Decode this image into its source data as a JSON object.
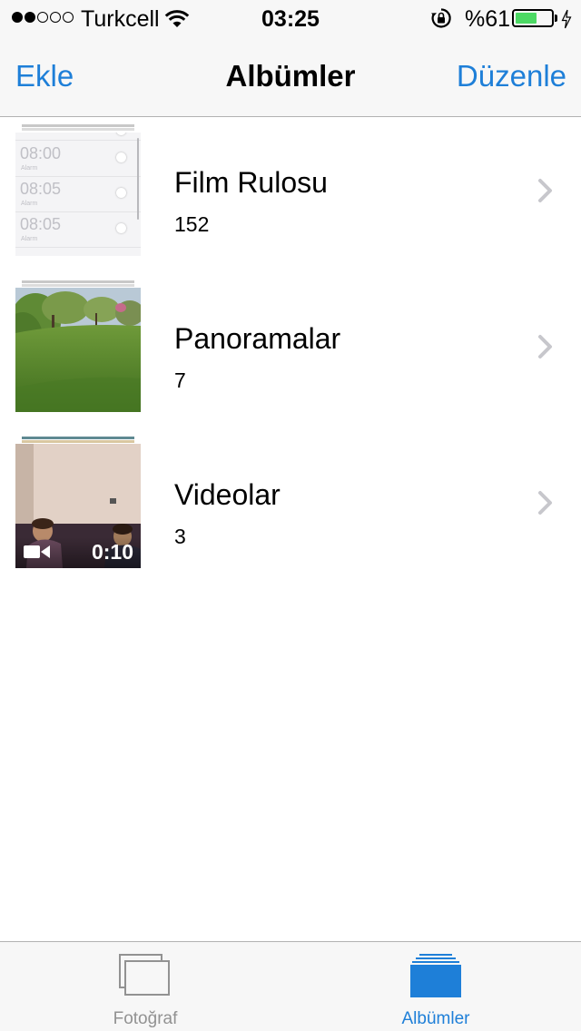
{
  "status_bar": {
    "carrier": "Turkcell",
    "time": "03:25",
    "battery_percent_text": "%61",
    "battery_level": 0.61,
    "signal_bars_filled": 2,
    "signal_bars_total": 5,
    "battery_color": "#4cd964"
  },
  "nav": {
    "left_label": "Ekle",
    "title": "Albümler",
    "right_label": "Düzenle",
    "tint_color": "#1e7fd8"
  },
  "albums": [
    {
      "title": "Film Rulosu",
      "count": "152",
      "thumbnail": {
        "kind": "alarm-screenshot",
        "rows": [
          {
            "time": "08:00",
            "sub": "Alarm"
          },
          {
            "time": "08:05",
            "sub": "Alarm"
          },
          {
            "time": "08:05",
            "sub": "Alarm"
          }
        ]
      }
    },
    {
      "title": "Panoramalar",
      "count": "7",
      "thumbnail": {
        "kind": "grass-park-photo"
      }
    },
    {
      "title": "Videolar",
      "count": "3",
      "thumbnail": {
        "kind": "room-video",
        "duration": "0:10",
        "icon": "video-camera-icon"
      }
    }
  ],
  "tab_bar": {
    "tabs": [
      {
        "label": "Fotoğraf",
        "icon": "photos-stack-icon",
        "selected": false,
        "color": "#929292"
      },
      {
        "label": "Albümler",
        "icon": "albums-icon",
        "selected": true,
        "color": "#1e7fd8"
      }
    ]
  }
}
